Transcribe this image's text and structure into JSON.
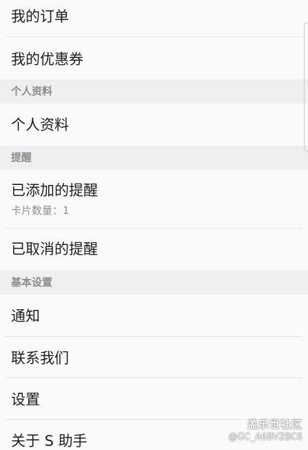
{
  "items": {
    "my_orders": "我的订单",
    "my_coupons": "我的优惠券",
    "profile": "个人资料",
    "added_reminders": "已添加的提醒",
    "added_reminders_sub": "卡片数量：1",
    "cancelled_reminders": "已取消的提醒",
    "notifications": "通知",
    "contact_us": "联系我们",
    "settings": "设置",
    "about": "关于 S 助手"
  },
  "sections": {
    "profile": "个人资料",
    "reminders": "提醒",
    "basic_settings": "基本设置"
  },
  "watermark": {
    "title": "盖乐世社区",
    "user": "@GC_A6BV2BC6"
  }
}
